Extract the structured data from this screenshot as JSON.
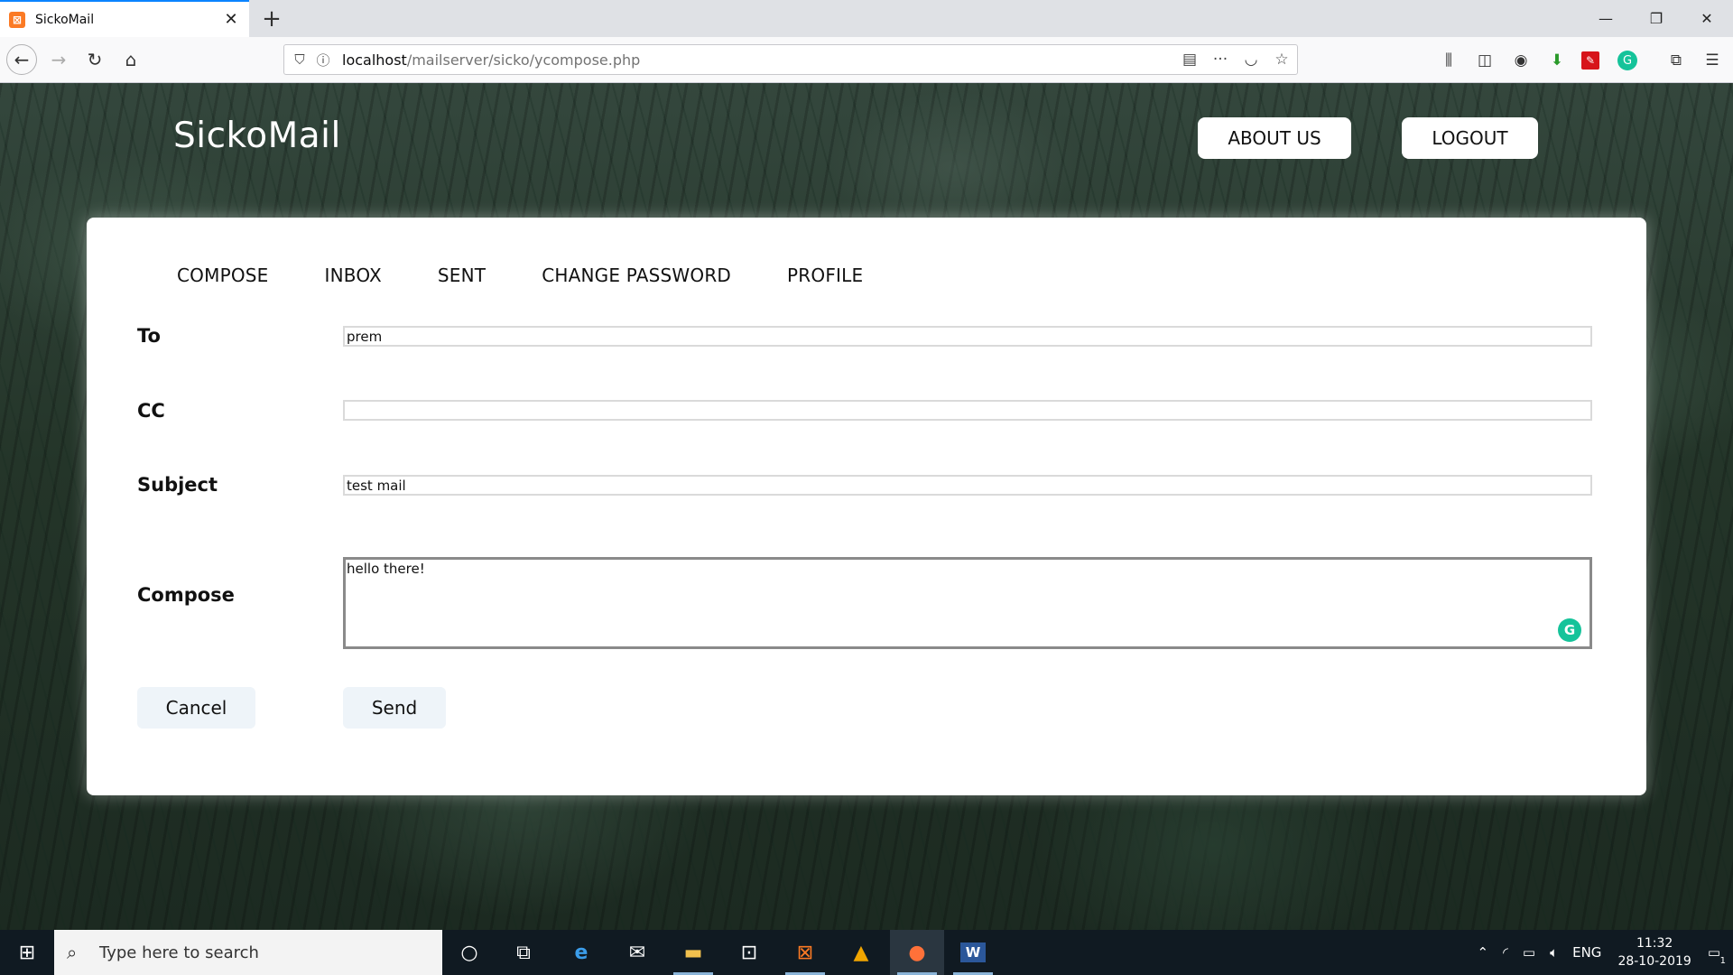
{
  "browser": {
    "tab_title": "SickoMail",
    "tab_favicon": "xampp-icon",
    "url_host": "localhost",
    "url_path": "/mailserver/sicko/ycompose.php"
  },
  "header": {
    "brand": "SickoMail",
    "about_label": "ABOUT US",
    "logout_label": "LOGOUT"
  },
  "menu": {
    "items": [
      "COMPOSE",
      "INBOX",
      "SENT",
      "CHANGE PASSWORD",
      "PROFILE"
    ]
  },
  "form": {
    "to_label": "To",
    "to_value": "prem",
    "cc_label": "CC",
    "cc_value": "",
    "subject_label": "Subject",
    "subject_value": "test mail",
    "compose_label": "Compose",
    "compose_value": "hello there!",
    "cancel_label": "Cancel",
    "send_label": "Send"
  },
  "taskbar": {
    "search_placeholder": "Type here to search",
    "language": "ENG",
    "time": "11:32",
    "date": "28-10-2019",
    "notification_count": "1"
  },
  "colors": {
    "accent": "#0a84ff",
    "grammarly": "#15c39a",
    "button_bg": "#eef4f9"
  }
}
